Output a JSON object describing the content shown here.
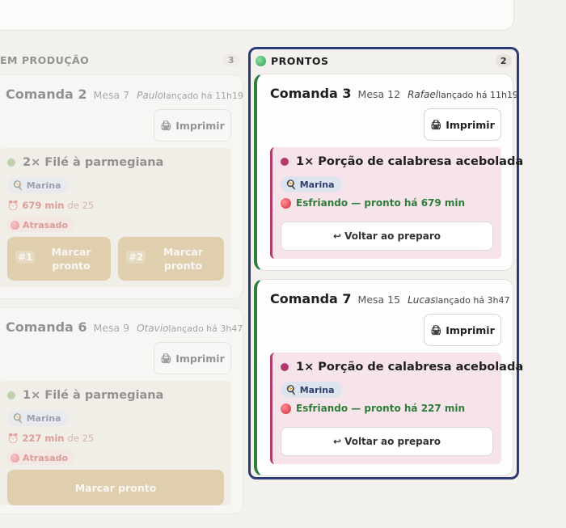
{
  "columns": {
    "in_production": {
      "title": "EM PRODUÇÃO",
      "count": "3",
      "cards": [
        {
          "comanda": "Comanda 2",
          "mesa": "Mesa 7",
          "waiter": "Paulo",
          "launched": "lançado há 11h19",
          "print_label": "Imprimir",
          "item": {
            "title": "2× Filé à parmegiana",
            "cook": "Marina",
            "timer_value": "679 min",
            "timer_of": "de 25",
            "late_label": "Atrasado",
            "buttons": [
              {
                "num": "#1",
                "label": "Marcar pronto"
              },
              {
                "num": "#2",
                "label": "Marcar pronto"
              }
            ]
          }
        },
        {
          "comanda": "Comanda 6",
          "mesa": "Mesa 9",
          "waiter": "Otavio",
          "launched": "lançado há 3h47",
          "print_label": "Imprimir",
          "item": {
            "title": "1× Filé à parmegiana",
            "cook": "Marina",
            "timer_value": "227 min",
            "timer_of": "de 25",
            "late_label": "Atrasado",
            "button_label": "Marcar pronto"
          }
        }
      ]
    },
    "ready": {
      "title": "PRONTOS",
      "count": "2",
      "cards": [
        {
          "comanda": "Comanda 3",
          "mesa": "Mesa 12",
          "waiter": "Rafael",
          "launched": "lançado há 11h19",
          "print_label": "Imprimir",
          "item": {
            "title": "1× Porção de calabresa acebolada",
            "cook": "Marina",
            "status": "Esfriando — pronto há 679 min",
            "back_label": "Voltar ao preparo"
          }
        },
        {
          "comanda": "Comanda 7",
          "mesa": "Mesa 15",
          "waiter": "Lucas",
          "launched": "lançado há 3h47",
          "print_label": "Imprimir",
          "item": {
            "title": "1× Porção de calabresa acebolada",
            "cook": "Marina",
            "status": "Esfriando — pronto há 227 min",
            "back_label": "Voltar ao preparo"
          }
        }
      ]
    }
  },
  "icons": {
    "print": "printer-icon",
    "cook": "chef-icon",
    "back": "return-arrow-icon",
    "timer": "alarm-clock-icon"
  },
  "colors": {
    "ready_border": "#2c3a78",
    "ready_accent": "#2f7d3a",
    "item_accent": "#b43a6e",
    "mark_button": "#c9a862"
  }
}
